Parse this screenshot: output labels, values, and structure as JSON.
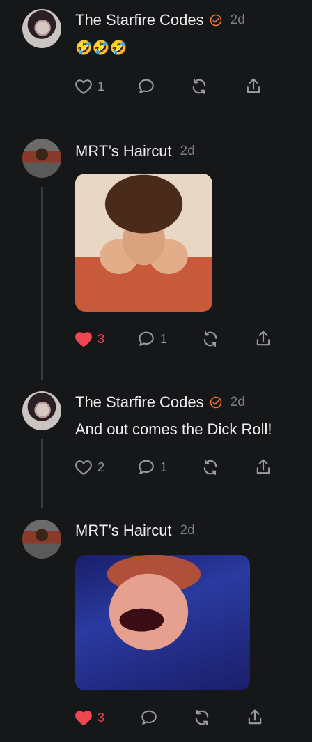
{
  "posts": [
    {
      "author": "The Starfire Codes",
      "verified": true,
      "time": "2d",
      "text": "🤣🤣🤣",
      "likes": "1",
      "replies": "",
      "liked": false
    },
    {
      "author": "MRT’s Haircut",
      "verified": false,
      "time": "2d",
      "likes": "3",
      "replies": "1",
      "liked": true
    },
    {
      "author": "The Starfire Codes",
      "verified": true,
      "time": "2d",
      "text": "And out comes the Dick Roll!",
      "likes": "2",
      "replies": "1",
      "liked": false
    },
    {
      "author": "MRT’s Haircut",
      "verified": false,
      "time": "2d",
      "likes": "3",
      "replies": "",
      "liked": true
    }
  ],
  "colors": {
    "accent_red": "#f0464f",
    "verified_orange": "#f07b3a",
    "background": "#161719"
  },
  "icons": [
    "heart-icon",
    "comment-icon",
    "repost-icon",
    "share-icon",
    "verified-badge-icon"
  ]
}
